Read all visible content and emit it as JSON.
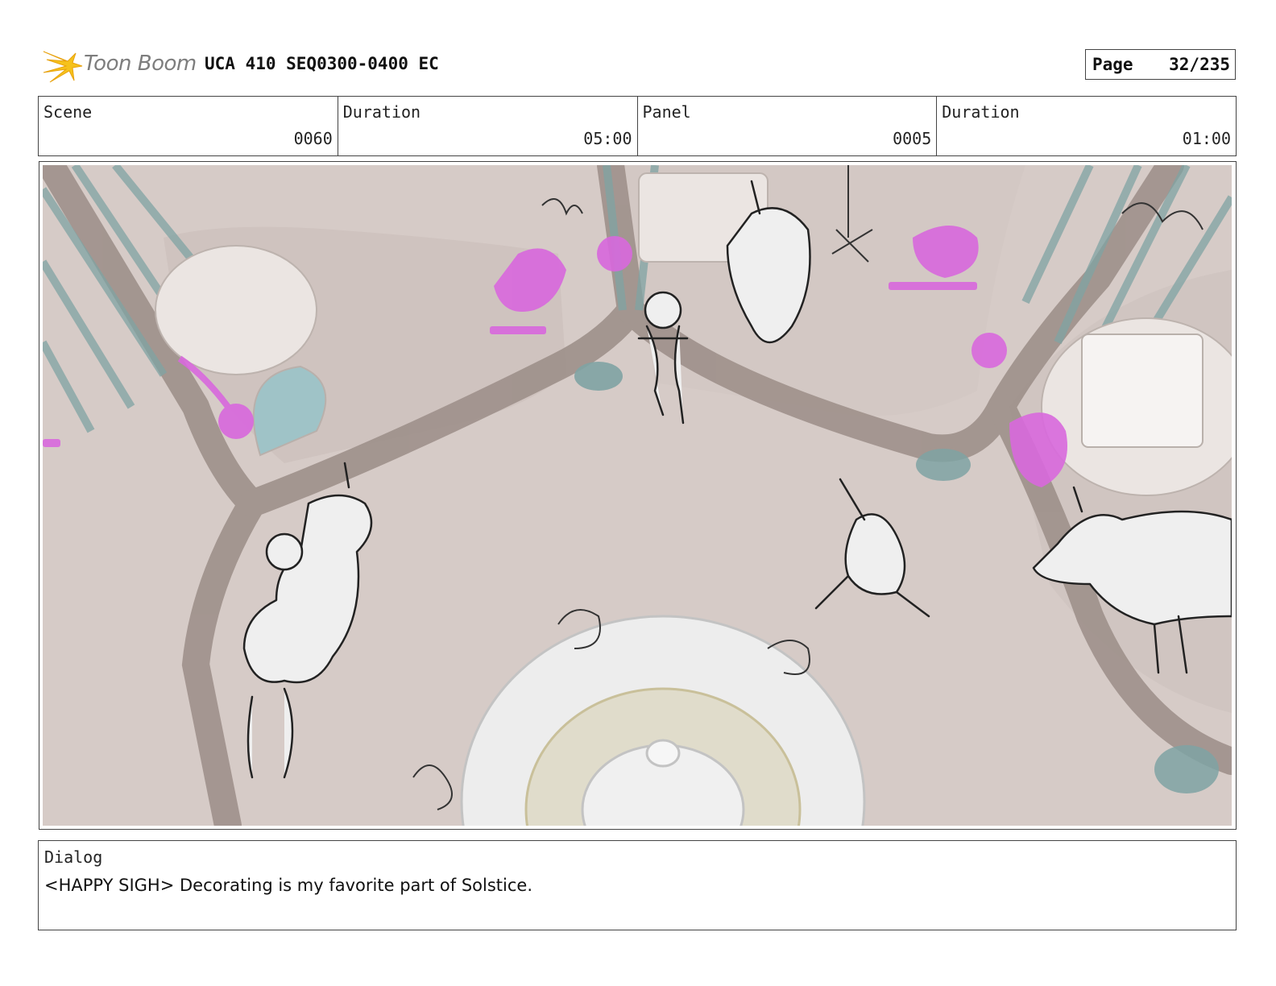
{
  "header": {
    "logo_text": "Toon Boom",
    "title": "UCA 410 SEQ0300-0400 EC",
    "page_label": "Page",
    "page_value": "32/235"
  },
  "info": {
    "scene_label": "Scene",
    "scene_value": "0060",
    "scene_duration_label": "Duration",
    "scene_duration_value": "05:00",
    "panel_label": "Panel",
    "panel_value": "0005",
    "panel_duration_label": "Duration",
    "panel_duration_value": "01:00"
  },
  "dialog": {
    "label": "Dialog",
    "text": "<HAPPY SIGH> Decorating is my favorite part of Solstice."
  },
  "colors": {
    "floor": "#d6cbc7",
    "beam": "#9b8d87",
    "lattice": "#7fa3a3",
    "magenta": "#d868dd",
    "logo_yellow": "#f6c21b"
  }
}
